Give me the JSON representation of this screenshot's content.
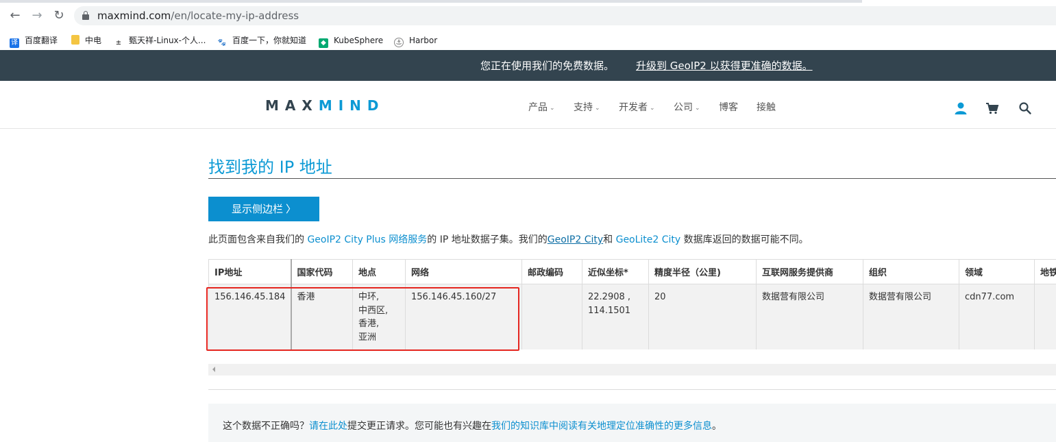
{
  "browser": {
    "url_host": "maxmind.com",
    "url_path": "/en/locate-my-ip-address",
    "bookmarks": [
      {
        "label": "百度翻译",
        "icon": "translate-icon",
        "color": "#1a73e8"
      },
      {
        "label": "中电",
        "icon": "folder-icon",
        "color": "#f4c542"
      },
      {
        "label": "甄天祥-Linux-个人...",
        "icon": "linux-blog-icon",
        "color": "#444444"
      },
      {
        "label": "百度一下，你就知道",
        "icon": "baidu-paw-icon",
        "color": "#2932e1"
      },
      {
        "label": "KubeSphere",
        "icon": "kubesphere-icon",
        "color": "#00a971"
      },
      {
        "label": "Harbor",
        "icon": "harbor-icon",
        "color": "#60b932"
      }
    ]
  },
  "banner": {
    "message": "您正在使用我们的免费数据。",
    "upgrade_link": "升级到 GeoIP2 以获得更准确的数据。"
  },
  "header": {
    "logo_part1": "MAX",
    "logo_part2": "MIND",
    "menu": [
      {
        "label": "产品",
        "has_dropdown": true
      },
      {
        "label": "支持",
        "has_dropdown": true
      },
      {
        "label": "开发者",
        "has_dropdown": true
      },
      {
        "label": "公司",
        "has_dropdown": true
      },
      {
        "label": "博客",
        "has_dropdown": false
      },
      {
        "label": "接触",
        "has_dropdown": false
      }
    ],
    "icons": [
      "account-icon",
      "cart-icon",
      "search-icon"
    ]
  },
  "page": {
    "title": "找到我的 IP 地址",
    "sidebar_button": "显示侧边栏",
    "intro": {
      "t1": "此页面包含来自我们的 ",
      "link1": "GeoIP2 City Plus 网络服务",
      "t2": "的 IP 地址数据子集。我们的",
      "link2": "GeoIP2 City",
      "t3": "和 ",
      "link3": "GeoLite2 City",
      "t4": " 数据库返回的数据可能不同。"
    }
  },
  "table": {
    "headers": [
      "IP地址",
      "国家代码",
      "地点",
      "网络",
      "邮政编码",
      "近似坐标*",
      "精度半径（公里)",
      "互联网服务提供商",
      "组织",
      "领域",
      "地铁"
    ],
    "row": {
      "ip": "156.146.45.184",
      "country": "香港",
      "location_lines": [
        "中环,",
        "中西区,",
        "香港,",
        "亚洲"
      ],
      "network": "156.146.45.160/27",
      "postal": "",
      "coords_lines": [
        "22.2908 ,",
        "114.1501"
      ],
      "accuracy": "20",
      "isp": "数据营有限公司",
      "org": "数据营有限公司",
      "domain": "cdn77.com",
      "metro": ""
    }
  },
  "footer": {
    "t1": "这个数据不正确吗？",
    "link1": "请在此处",
    "t2": "提交更正请求。您可能也有兴趣在",
    "link2": "我们的知识库中阅读有关地理定位准确性的更多信息",
    "t3": "。"
  },
  "colors": {
    "banner_bg": "#33444f",
    "brand_blue": "#0c9ad5",
    "button_blue": "#0c8fcf",
    "highlight_red": "#e5251f"
  }
}
